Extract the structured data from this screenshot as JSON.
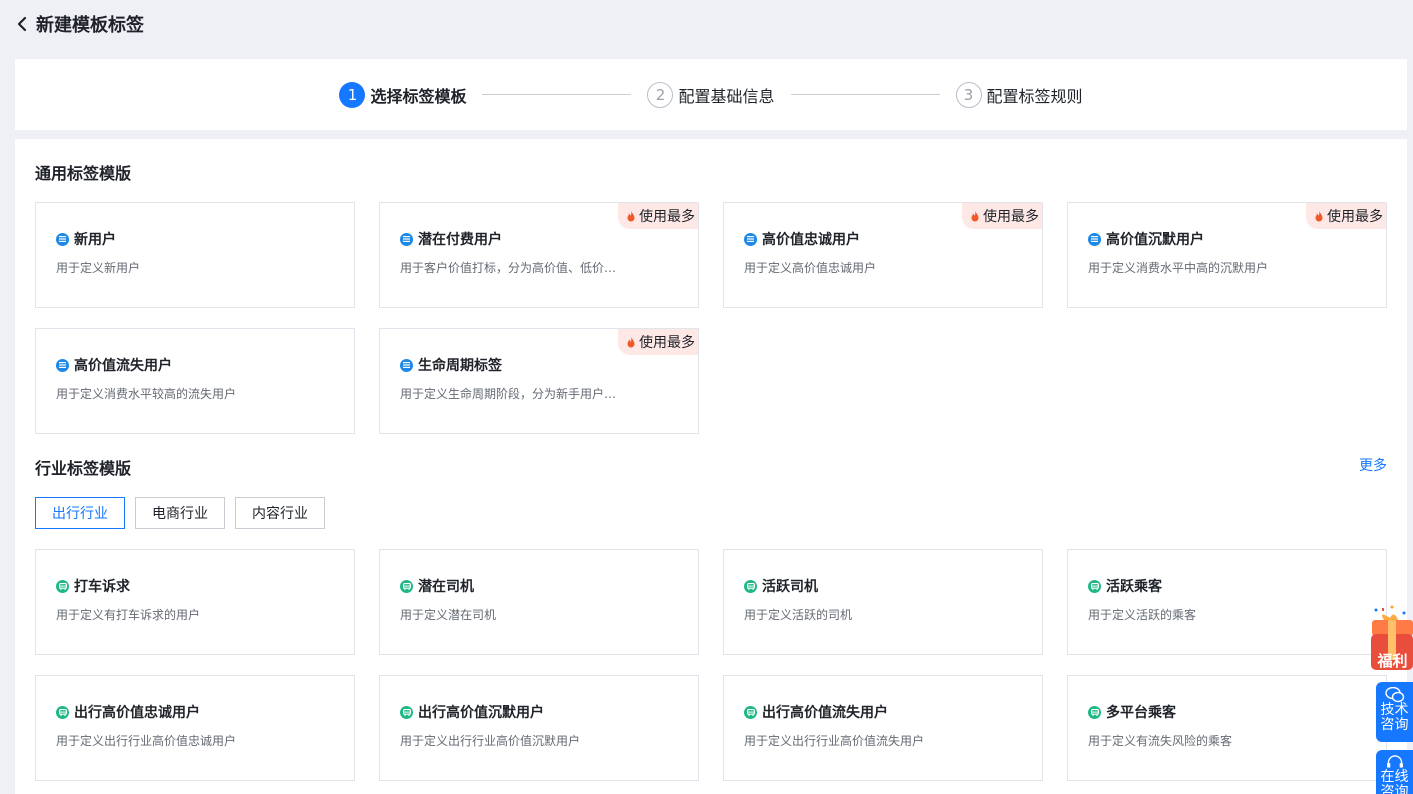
{
  "header": {
    "title": "新建模板标签"
  },
  "steps": [
    {
      "num": "1",
      "label": "选择标签模板"
    },
    {
      "num": "2",
      "label": "配置基础信息"
    },
    {
      "num": "3",
      "label": "配置标签规则"
    }
  ],
  "general": {
    "title": "通用标签模版",
    "cards": [
      {
        "title": "新用户",
        "desc": "用于定义新用户",
        "hot": ""
      },
      {
        "title": "潜在付费用户",
        "desc": "用于客户价值打标，分为高价值、低价…",
        "hot": "使用最多"
      },
      {
        "title": "高价值忠诚用户",
        "desc": "用于定义高价值忠诚用户",
        "hot": "使用最多"
      },
      {
        "title": "高价值沉默用户",
        "desc": "用于定义消费水平中高的沉默用户",
        "hot": "使用最多"
      },
      {
        "title": "高价值流失用户",
        "desc": "用于定义消费水平较高的流失用户",
        "hot": ""
      },
      {
        "title": "生命周期标签",
        "desc": "用于定义生命周期阶段，分为新手用户…",
        "hot": "使用最多"
      }
    ]
  },
  "industry": {
    "title": "行业标签模版",
    "more": "更多",
    "tabs": [
      "出行行业",
      "电商行业",
      "内容行业"
    ],
    "cards": [
      {
        "title": "打车诉求",
        "desc": "用于定义有打车诉求的用户"
      },
      {
        "title": "潜在司机",
        "desc": "用于定义潜在司机"
      },
      {
        "title": "活跃司机",
        "desc": "用于定义活跃的司机"
      },
      {
        "title": "活跃乘客",
        "desc": "用于定义活跃的乘客"
      },
      {
        "title": "出行高价值忠诚用户",
        "desc": "用于定义出行行业高价值忠诚用户"
      },
      {
        "title": "出行高价值沉默用户",
        "desc": "用于定义出行行业高价值沉默用户"
      },
      {
        "title": "出行高价值流失用户",
        "desc": "用于定义出行行业高价值流失用户"
      },
      {
        "title": "多平台乘客",
        "desc": "用于定义有流失风险的乘客"
      }
    ]
  },
  "floating": {
    "gift": "福利",
    "tech": "技术咨询",
    "online": "在线咨询"
  },
  "colors": {
    "primary": "#1677ff",
    "general_icon": "#1e88e5",
    "industry_icon": "#1fb886",
    "hot_bg": "#fde8e6",
    "hot_flame": "#f05a28"
  },
  "icons": {
    "back": "chevron-left-icon",
    "general_card": "list-icon",
    "industry_card": "car-icon",
    "hot": "fire-icon",
    "tech": "wechat-icon",
    "online": "headset-icon",
    "gift": "gift-box-icon"
  }
}
